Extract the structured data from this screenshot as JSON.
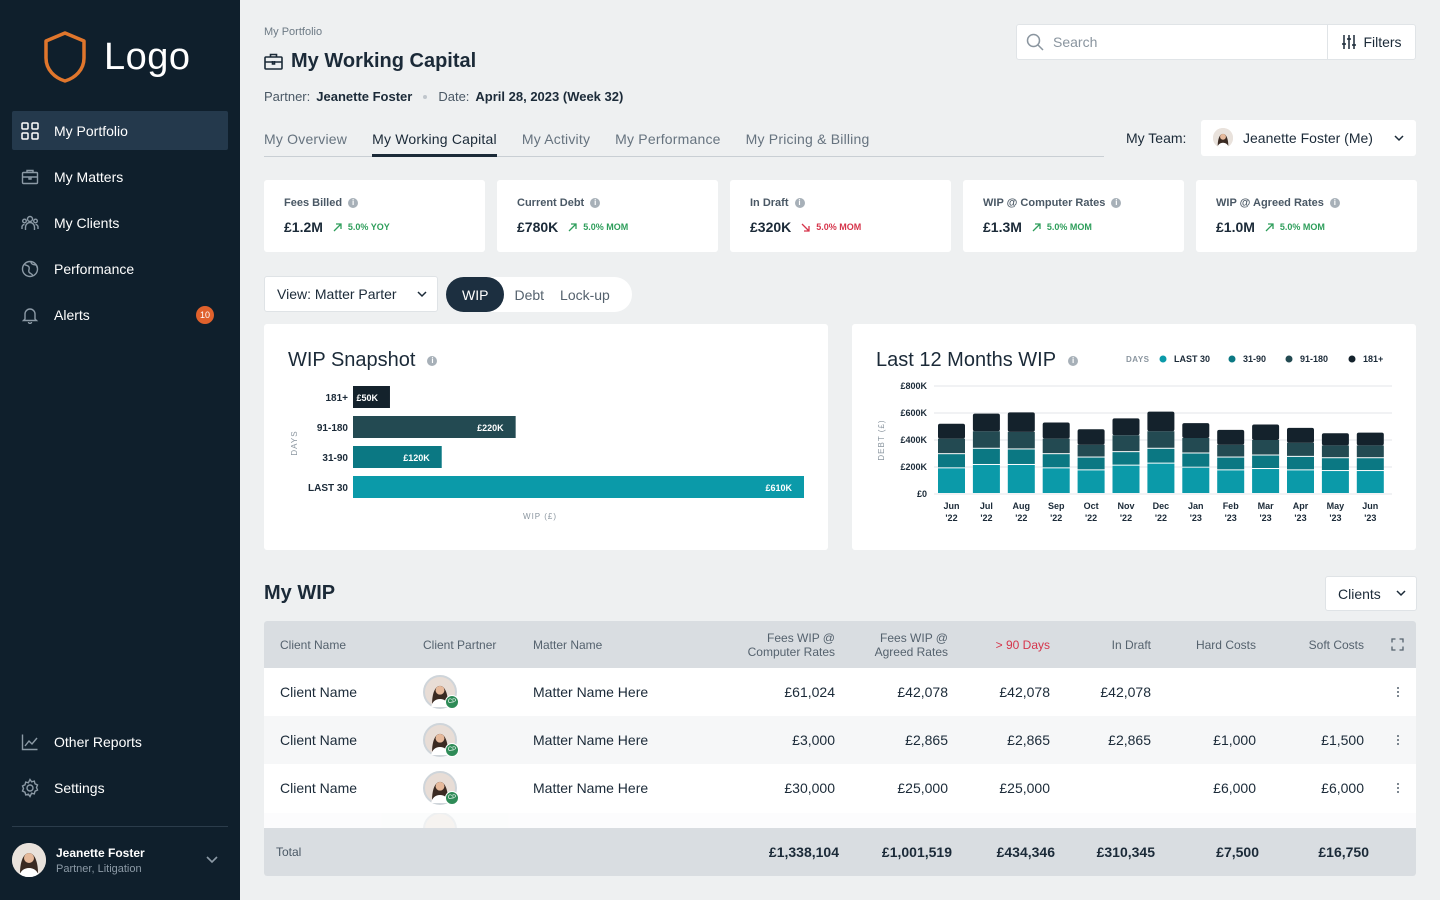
{
  "brand": {
    "logo_text": "Logo"
  },
  "sidebar": {
    "items": [
      {
        "label": "My Portfolio",
        "icon": "grid-icon",
        "active": true
      },
      {
        "label": "My Matters",
        "icon": "briefcase-icon"
      },
      {
        "label": "My Clients",
        "icon": "people-icon"
      },
      {
        "label": "Performance",
        "icon": "globe-icon"
      },
      {
        "label": "Alerts",
        "icon": "bell-icon",
        "badge": "10"
      }
    ],
    "bottom_items": [
      {
        "label": "Other Reports",
        "icon": "line-chart-icon"
      },
      {
        "label": "Settings",
        "icon": "gear-icon"
      }
    ],
    "user": {
      "name": "Jeanette Foster",
      "role": "Partner, Litigation"
    }
  },
  "header": {
    "breadcrumb": "My Portfolio",
    "title": "My Working Capital",
    "partner_label": "Partner:",
    "partner_value": "Jeanette Foster",
    "date_label": "Date:",
    "date_value": "April 28, 2023 (Week 32)",
    "search_placeholder": "Search",
    "filters_label": "Filters"
  },
  "tabs": [
    "My Overview",
    "My Working Capital",
    "My Activity",
    "My Performance",
    "My Pricing & Billing"
  ],
  "active_tab": "My Working Capital",
  "team": {
    "label": "My Team:",
    "value": "Jeanette Foster (Me)"
  },
  "kpis": [
    {
      "label": "Fees Billed",
      "value": "£1.2M",
      "trend": "5.0% YOY",
      "direction": "up"
    },
    {
      "label": "Current Debt",
      "value": "£780K",
      "trend": "5.0% MOM",
      "direction": "up"
    },
    {
      "label": "In Draft",
      "value": "£320K",
      "trend": "5.0% MOM",
      "direction": "down"
    },
    {
      "label": "WIP @ Computer Rates",
      "value": "£1.3M",
      "trend": "5.0% MOM",
      "direction": "up"
    },
    {
      "label": "WIP @ Agreed Rates",
      "value": "£1.0M",
      "trend": "5.0% MOM",
      "direction": "up"
    }
  ],
  "controls": {
    "view_select": "View: Matter Parter",
    "segments": [
      "WIP",
      "Debt",
      "Lock-up"
    ],
    "active_segment": "WIP"
  },
  "colors": {
    "up": "#2e9e5b",
    "down": "#d6354b",
    "last30": "#0b9aa9",
    "d31_90": "#0b7883",
    "d91_180": "#234a52",
    "d181": "#14222c"
  },
  "chart_data": [
    {
      "type": "bar",
      "orientation": "horizontal",
      "title": "WIP Snapshot",
      "xlabel": "WIP (£)",
      "ylabel": "DAYS",
      "categories": [
        "181+",
        "91-180",
        "31-90",
        "LAST 30"
      ],
      "values": [
        50,
        220,
        120,
        610
      ],
      "value_labels": [
        "£50K",
        "£220K",
        "£120K",
        "£610K"
      ],
      "unit": "£K"
    },
    {
      "type": "bar",
      "stacked": true,
      "title": "Last 12 Months WIP",
      "ylabel": "DEBT (£)",
      "legend_title": "DAYS",
      "legend_position": "top-right",
      "grid": true,
      "ylim": [
        0,
        800
      ],
      "yticks": [
        "£0",
        "£200K",
        "£400K",
        "£600K",
        "£800K"
      ],
      "ytick_values": [
        0,
        200,
        400,
        600,
        800
      ],
      "categories": [
        [
          "Jun",
          "'22"
        ],
        [
          "Jul",
          "'22"
        ],
        [
          "Aug",
          "'22"
        ],
        [
          "Sep",
          "'22"
        ],
        [
          "Oct",
          "'22"
        ],
        [
          "Nov",
          "'22"
        ],
        [
          "Dec",
          "'22"
        ],
        [
          "Jan",
          "'23"
        ],
        [
          "Feb",
          "'23"
        ],
        [
          "Mar",
          "'23"
        ],
        [
          "Apr",
          "'23"
        ],
        [
          "May",
          "'23"
        ],
        [
          "Jun",
          "'23"
        ]
      ],
      "series": [
        {
          "name": "LAST 30",
          "values": [
            190,
            215,
            215,
            190,
            175,
            210,
            225,
            195,
            175,
            185,
            175,
            170,
            170
          ]
        },
        {
          "name": "31-90",
          "values": [
            105,
            120,
            115,
            105,
            95,
            100,
            110,
            105,
            95,
            100,
            100,
            95,
            95
          ]
        },
        {
          "name": "91-180",
          "values": [
            115,
            130,
            130,
            115,
            95,
            125,
            130,
            115,
            95,
            115,
            105,
            95,
            95
          ]
        },
        {
          "name": "181+",
          "values": [
            110,
            130,
            145,
            120,
            115,
            125,
            145,
            110,
            110,
            115,
            110,
            90,
            95
          ]
        }
      ]
    }
  ],
  "wip": {
    "title": "My WIP",
    "group_select": "Clients",
    "columns": {
      "client": "Client Name",
      "partner": "Client Partner",
      "matter": "Matter Name",
      "fees_comp_1": "Fees WIP @",
      "fees_comp_2": "Computer Rates",
      "fees_agreed_1": "Fees WIP @",
      "fees_agreed_2": "Agreed Rates",
      "over90": "> 90 Days",
      "draft": "In Draft",
      "hard": "Hard Costs",
      "soft": "Soft Costs"
    },
    "partner_badge": "CP",
    "rows": [
      {
        "client": "Client Name",
        "matter": "Matter Name Here",
        "fees_comp": "£61,024",
        "fees_agreed": "£42,078",
        "over90": "£42,078",
        "draft": "£42,078",
        "hard": "",
        "soft": ""
      },
      {
        "client": "Client Name",
        "matter": "Matter Name Here",
        "fees_comp": "£3,000",
        "fees_agreed": "£2,865",
        "over90": "£2,865",
        "draft": "£2,865",
        "hard": "£1,000",
        "soft": "£1,500"
      },
      {
        "client": "Client Name",
        "matter": "Matter Name Here",
        "fees_comp": "£30,000",
        "fees_agreed": "£25,000",
        "over90": "£25,000",
        "draft": "",
        "hard": "£6,000",
        "soft": "£6,000"
      }
    ],
    "total": {
      "label": "Total",
      "fees_comp": "£1,338,104",
      "fees_agreed": "£1,001,519",
      "over90": "£434,346",
      "draft": "£310,345",
      "hard": "£7,500",
      "soft": "£16,750"
    }
  }
}
